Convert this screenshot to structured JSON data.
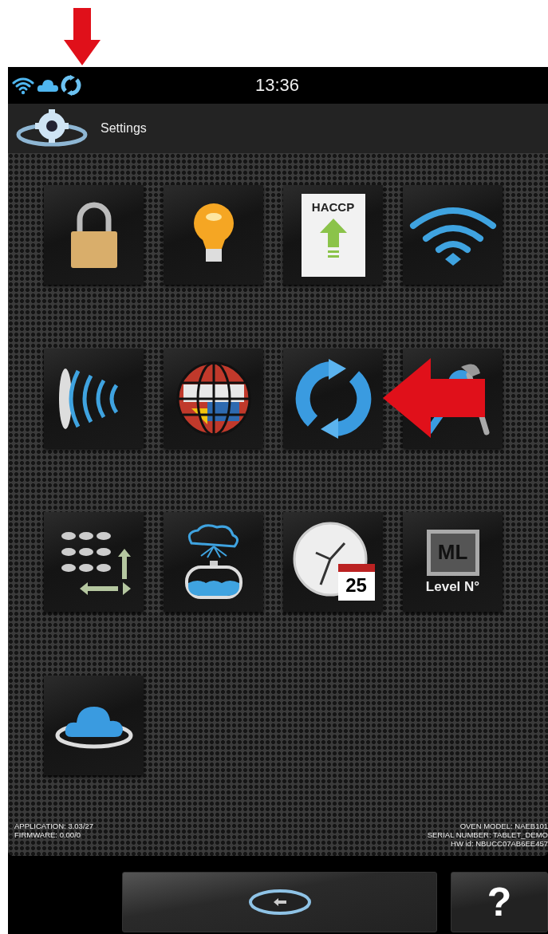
{
  "status_bar": {
    "time": "13:36"
  },
  "header": {
    "title": "Settings"
  },
  "tiles": [
    {
      "kind": "lock"
    },
    {
      "kind": "bulb"
    },
    {
      "kind": "haccp",
      "text": "HACCP"
    },
    {
      "kind": "wifi"
    },
    {
      "kind": "sound"
    },
    {
      "kind": "globe"
    },
    {
      "kind": "sync"
    },
    {
      "kind": "tools"
    },
    {
      "kind": "trays"
    },
    {
      "kind": "water"
    },
    {
      "kind": "clock",
      "text": "25"
    },
    {
      "kind": "level",
      "logo": "ML",
      "text": "Level N°"
    },
    {
      "kind": "cloud"
    }
  ],
  "footer": {
    "left": [
      "APPLICATION: 3.03/27",
      "FIRMWARE: 0.00/0"
    ],
    "right": [
      "OVEN MODEL: NAEB101",
      "SERIAL NUMBER: TABLET_DEMO",
      "HW id: NBUCC07AB6EE457"
    ]
  },
  "bottom_bar": {
    "help_button": {
      "label": "?"
    }
  },
  "annotations": [
    {
      "kind": "down"
    },
    {
      "kind": "left"
    }
  ]
}
